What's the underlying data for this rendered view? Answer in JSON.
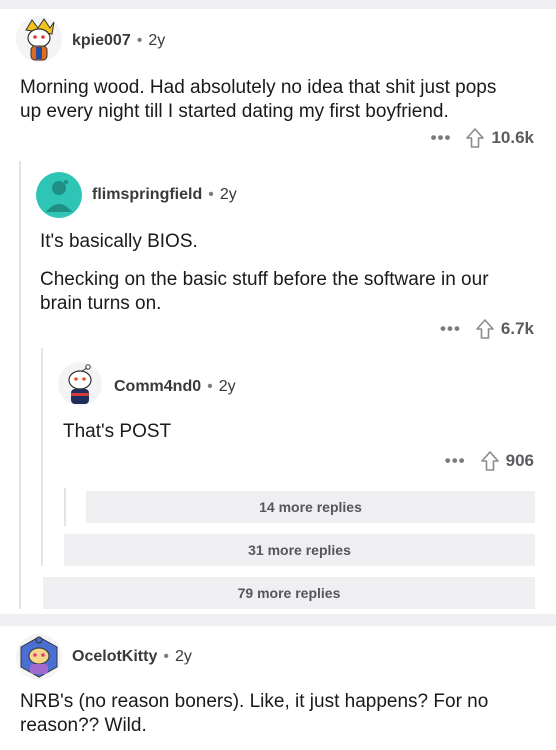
{
  "comments": [
    {
      "user": "kpie007",
      "separator": "•",
      "age": "2y",
      "body_lines": [
        "Morning wood. Had absolutely no idea that shit just pops",
        "up every night till I started dating my first boyfriend."
      ],
      "more": "•••",
      "score": "10.6k"
    },
    {
      "user": "flimspringfield",
      "separator": "•",
      "age": "2y",
      "body_lines": [
        "It's basically BIOS."
      ],
      "body2_lines": [
        "Checking on the basic stuff before the software in our",
        "brain turns on."
      ],
      "more": "•••",
      "score": "6.7k"
    },
    {
      "user": "Comm4nd0",
      "separator": "•",
      "age": "2y",
      "body_lines": [
        "That's POST"
      ],
      "more": "•••",
      "score": "906"
    },
    {
      "user": "OcelotKitty",
      "separator": "•",
      "age": "2y",
      "body_lines": [
        "NRB's (no reason boners). Like, it just happens? For no",
        "reason?? Wild."
      ]
    }
  ],
  "more_replies": [
    "14 more replies",
    "31 more replies",
    "79 more replies"
  ],
  "colors": {
    "band": "#efeff1",
    "thread": "#e4e4e6",
    "meta": "#7c7c80",
    "teal": "#2ec4b6"
  },
  "icons": [
    "more-options-icon",
    "upvote-arrow-icon"
  ]
}
